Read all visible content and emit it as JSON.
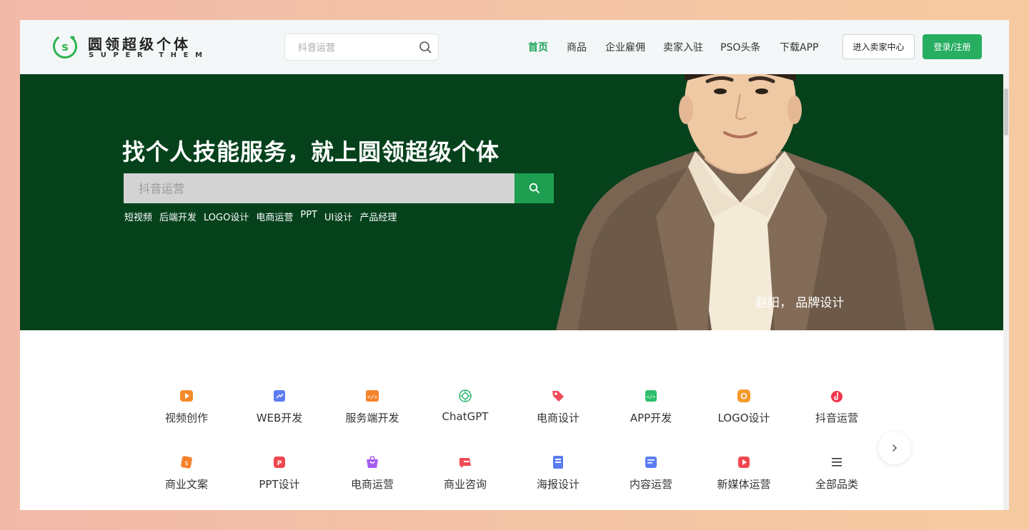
{
  "header": {
    "logo_title": "圆领超级个体",
    "logo_sub": "SUPER THEM",
    "search_placeholder": "抖音运营",
    "nav": [
      "首页",
      "商品",
      "企业雇佣",
      "卖家入驻",
      "PSO头条",
      "下载APP"
    ],
    "active_nav": "首页",
    "seller_button": "进入卖家中心",
    "login_button": "登录/注册"
  },
  "hero": {
    "title": "找个人技能服务，就上圆领超级个体",
    "search_placeholder": "抖音运营",
    "hot_tags": [
      "短视频",
      "后端开发",
      "LOGO设计",
      "电商运营",
      "PPT",
      "UI设计",
      "产品经理"
    ],
    "caption": "赵阳， 品牌设计",
    "background_color": "#05421c"
  },
  "categories": [
    {
      "label": "视频创作",
      "icon": "video-creation-icon",
      "color": "#f58a2b"
    },
    {
      "label": "WEB开发",
      "icon": "web-dev-icon",
      "color": "#5b7cf2"
    },
    {
      "label": "服务端开发",
      "icon": "server-dev-icon",
      "color": "#f5832b"
    },
    {
      "label": "ChatGPT",
      "icon": "chatgpt-icon",
      "color": "#2fb36d"
    },
    {
      "label": "电商设计",
      "icon": "ecommerce-design-icon",
      "color": "#f04b5a"
    },
    {
      "label": "APP开发",
      "icon": "app-dev-icon",
      "color": "#2fbf6b"
    },
    {
      "label": "LOGO设计",
      "icon": "logo-design-icon",
      "color": "#f59a2b"
    },
    {
      "label": "抖音运营",
      "icon": "douyin-icon",
      "color": "#f0374a"
    },
    {
      "label": "商业文案",
      "icon": "business-copy-icon",
      "color": "#f5822b"
    },
    {
      "label": "PPT设计",
      "icon": "ppt-design-icon",
      "color": "#f0474f"
    },
    {
      "label": "电商运营",
      "icon": "ecommerce-ops-icon",
      "color": "#a65cf0"
    },
    {
      "label": "商业咨询",
      "icon": "business-consult-icon",
      "color": "#f04b55"
    },
    {
      "label": "海报设计",
      "icon": "poster-design-icon",
      "color": "#5b7cf2"
    },
    {
      "label": "内容运营",
      "icon": "content-ops-icon",
      "color": "#5b7cf2"
    },
    {
      "label": "新媒体运营",
      "icon": "new-media-icon",
      "color": "#f0474f"
    },
    {
      "label": "全部品类",
      "icon": "menu-icon",
      "color": "#333333"
    }
  ],
  "accent_color": "#27ae60"
}
